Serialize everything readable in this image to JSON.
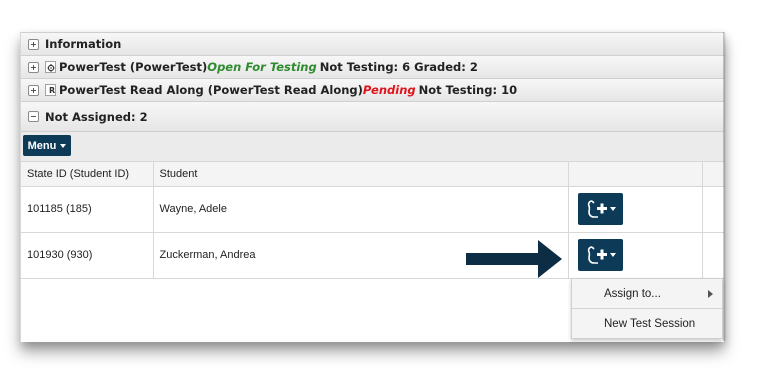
{
  "sections": [
    {
      "label": "Information",
      "state": "collapsed"
    },
    {
      "prefix": "PowerTest (PowerTest)",
      "status": "Open For Testing",
      "suffix": "Not Testing: 6 Graded: 2",
      "icon": "test-settings-icon",
      "state": "collapsed"
    },
    {
      "prefix": "PowerTest Read Along (PowerTest Read Along)",
      "status": "Pending",
      "suffix": "Not Testing: 10",
      "icon": "read-along-icon",
      "icon_glyph": "R",
      "state": "collapsed"
    },
    {
      "label": "Not Assigned: 2",
      "state": "expanded"
    }
  ],
  "toolbar": {
    "menu_label": "Menu"
  },
  "table": {
    "columns": [
      "State ID (Student ID)",
      "Student",
      "",
      ""
    ],
    "rows": [
      {
        "id": "101185 (185)",
        "student": "Wayne, Adele",
        "action_icon": "assign-student-icon"
      },
      {
        "id": "101930 (930)",
        "student": "Zuckerman, Andrea",
        "action_icon": "assign-student-icon"
      }
    ]
  },
  "dropdown": {
    "items": [
      {
        "label": "Assign to...",
        "has_submenu": true
      },
      {
        "label": "New Test Session",
        "has_submenu": false
      }
    ]
  },
  "colors": {
    "accent": "#0c3a57",
    "status_open": "#2e8b2e",
    "status_pending": "#e0141c",
    "arrow": "#0d2d44"
  }
}
